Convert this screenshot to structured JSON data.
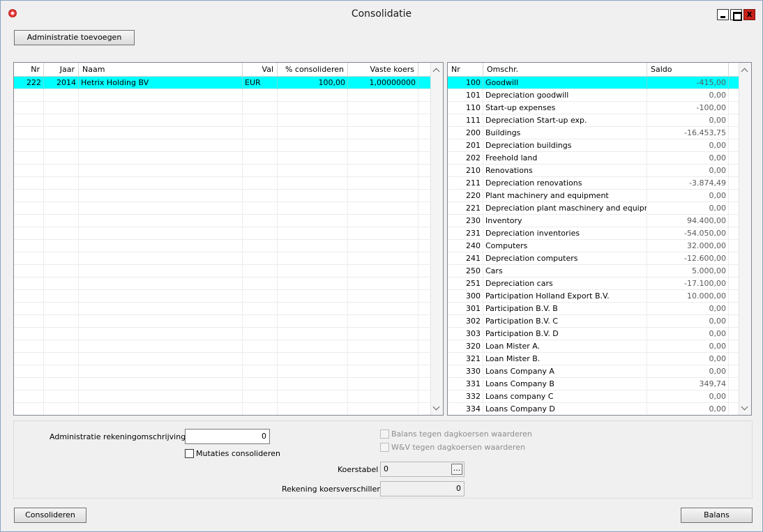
{
  "window": {
    "title": "Consolidatie",
    "close_symbol": "x"
  },
  "toolbar": {
    "add_admin_label": "Administratie toevoegen"
  },
  "left_grid": {
    "columns": [
      "Nr",
      "Jaar",
      "Naam",
      "Val",
      "% consolideren",
      "Vaste koers"
    ],
    "rows": [
      [
        "222",
        "2014",
        "Hetrix Holding BV",
        "EUR",
        "100,00",
        "1,00000000"
      ]
    ]
  },
  "right_grid": {
    "columns": [
      "Nr",
      "Omschr.",
      "Saldo"
    ],
    "rows": [
      [
        "100",
        "Goodwill",
        "-415,00"
      ],
      [
        "101",
        "Depreciation goodwill",
        "0,00"
      ],
      [
        "110",
        "Start-up expenses",
        "-100,00"
      ],
      [
        "111",
        "Depreciation  Start-up exp.",
        "0,00"
      ],
      [
        "200",
        "Buildings",
        "-16.453,75"
      ],
      [
        "201",
        "Depreciation buildings",
        "0,00"
      ],
      [
        "202",
        "Freehold land",
        "0,00"
      ],
      [
        "210",
        "Renovations",
        "0,00"
      ],
      [
        "211",
        "Depreciation renovations",
        "-3.874,49"
      ],
      [
        "220",
        "Plant machinery and equipment",
        "0,00"
      ],
      [
        "221",
        "Depreciation plant maschinery and equipme",
        "0,00"
      ],
      [
        "230",
        "Inventory",
        "94.400,00"
      ],
      [
        "231",
        "Depreciation inventories",
        "-54.050,00"
      ],
      [
        "240",
        "Computers",
        "32.000,00"
      ],
      [
        "241",
        "Depreciation computers",
        "-12.600,00"
      ],
      [
        "250",
        "Cars",
        "5.000,00"
      ],
      [
        "251",
        "Depreciation cars",
        "-17.100,00"
      ],
      [
        "300",
        "Participation Holland Export B.V.",
        "10.000,00"
      ],
      [
        "301",
        "Participation B.V. B",
        "0,00"
      ],
      [
        "302",
        "Participation B.V. C",
        "0,00"
      ],
      [
        "303",
        "Participation B.V. D",
        "0,00"
      ],
      [
        "320",
        "Loan Mister A.",
        "0,00"
      ],
      [
        "321",
        "Loan Mister B.",
        "0,00"
      ],
      [
        "330",
        "Loans Company A",
        "0,00"
      ],
      [
        "331",
        "Loans Company B",
        "349,74"
      ],
      [
        "332",
        "Loans company C",
        "0,00"
      ],
      [
        "334",
        "Loans Company D",
        "0,00"
      ]
    ]
  },
  "form": {
    "admin_account_desc_label": "Administratie rekeningomschrijving",
    "admin_account_desc_value": "0",
    "mutaties_label": "Mutaties consolideren",
    "balans_label": "Balans tegen dagkoersen waarderen",
    "wv_label": "W&V tegen dagkoersen waarderen",
    "koerstabel_label": "Koerstabel",
    "koerstabel_value": "0",
    "koerstabel_btn": "...",
    "rekening_label": "Rekening koersverschillen",
    "rekening_value": "0"
  },
  "footer": {
    "consolideren_label": "Consolideren",
    "balans_label": "Balans"
  }
}
